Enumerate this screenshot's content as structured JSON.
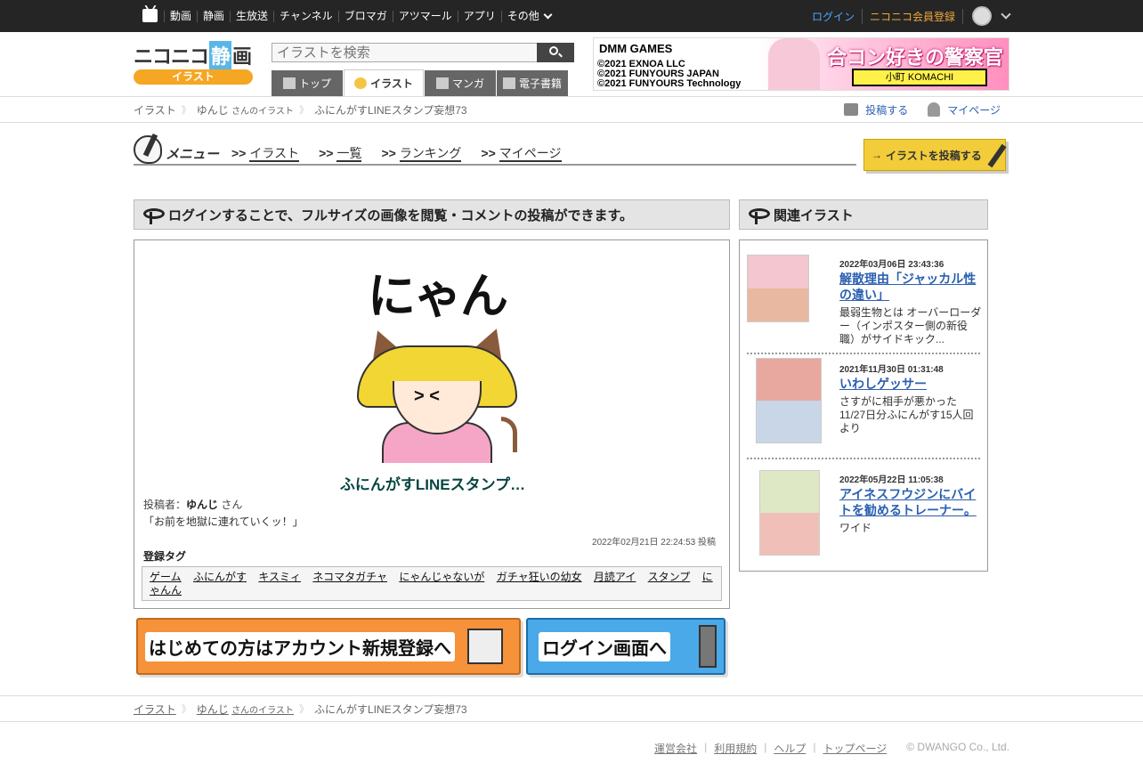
{
  "global_nav": {
    "items": [
      "動画",
      "静画",
      "生放送",
      "チャンネル",
      "ブロマガ",
      "アツマール",
      "アプリ",
      "その他"
    ],
    "login": "ログイン",
    "register": "ニコニコ会員登録"
  },
  "header": {
    "logo_main_1": "ニコニコ",
    "logo_main_2": "静",
    "logo_main_3": "画",
    "logo_sub": "イラスト",
    "search_placeholder": "イラストを検索",
    "tabs": [
      "トップ",
      "イラスト",
      "マンガ",
      "電子書籍"
    ]
  },
  "ad": {
    "brand": "DMM GAMES",
    "copyright_lines": [
      "©2021 EXNOA LLC",
      "©2021 FUNYOURS JAPAN",
      "©2021 FUNYOURS Technology"
    ],
    "title": "合コン好きの警察官",
    "name_tag": "小町 KOMACHI"
  },
  "breadcrumb": {
    "root": "イラスト",
    "user": "ゆんじ",
    "user_suffix": "さんのイラスト",
    "current": "ふにんがすLINEスタンプ妄想73",
    "post_link": "投稿する",
    "mypage_link": "マイページ"
  },
  "menu": {
    "label": "メニュー",
    "prefix": ">>",
    "items": [
      "イラスト",
      "一覧",
      "ランキング",
      "マイページ"
    ],
    "post_button": "イラストを投稿する"
  },
  "main": {
    "notice": "ログインすることで、フルサイズの画像を閲覧・コメントの投稿ができます。",
    "art_text": "にゃん",
    "title": "ふにんがすLINEスタンプ…",
    "poster_label": "投稿者：",
    "poster_name": "ゆんじ",
    "poster_suffix": " さん",
    "description": "「お前を地獄に連れていくッ！」",
    "posted_at": "2022年02月21日 22:24:53 投稿",
    "tags_heading": "登録タグ",
    "tags": [
      "ゲーム",
      "ふにんがす",
      "キスミィ",
      "ネコマタガチャ",
      "にゃんじゃないが",
      "ガチャ狂いの幼女",
      "月読アイ",
      "スタンプ",
      "にゃんん"
    ]
  },
  "buttons": {
    "register": "はじめての方はアカウント新規登録へ",
    "login": "ログイン画面へ"
  },
  "side": {
    "heading": "関連イラスト",
    "items": [
      {
        "date": "2022年03月06日 23:43:36",
        "title": "解散理由「ジャッカル性の違い」",
        "desc": "最弱生物とは オーバーローダー（インポスター側の新役職）がサイドキック..."
      },
      {
        "date": "2021年11月30日 01:31:48",
        "title": "いわしゲッサー",
        "desc": "さすがに相手が悪かった 11/27日分ふにんがす15人回より"
      },
      {
        "date": "2022年05月22日 11:05:38",
        "title": "アイネスフウジンにバイトを勧めるトレーナー。",
        "desc": "ワイド"
      }
    ]
  },
  "footer": {
    "links": [
      "運営会社",
      "利用規約",
      "ヘルプ",
      "トップページ"
    ],
    "copyright": "© DWANGO Co., Ltd."
  }
}
